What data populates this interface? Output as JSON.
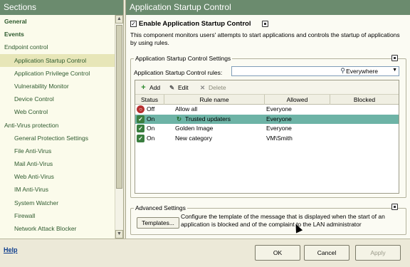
{
  "sidebar": {
    "title": "Sections",
    "items": [
      {
        "label": "General"
      },
      {
        "label": "Events"
      },
      {
        "label": "Endpoint control"
      },
      {
        "label": "Application Startup Control"
      },
      {
        "label": "Application Privilege Control"
      },
      {
        "label": "Vulnerability Monitor"
      },
      {
        "label": "Device Control"
      },
      {
        "label": "Web Control"
      },
      {
        "label": "Anti-Virus protection"
      },
      {
        "label": "General Protection Settings"
      },
      {
        "label": "File Anti-Virus"
      },
      {
        "label": "Mail Anti-Virus"
      },
      {
        "label": "Web Anti-Virus"
      },
      {
        "label": "IM Anti-Virus"
      },
      {
        "label": "System Watcher"
      },
      {
        "label": "Firewall"
      },
      {
        "label": "Network Attack Blocker"
      }
    ]
  },
  "main": {
    "title": "Application Startup Control",
    "enable_checkbox": {
      "label": "Enable Application Startup Control",
      "checked_mark": "✓"
    },
    "description": "This component monitors users' attempts to start applications and controls the startup of applications by using rules.",
    "settings_group": {
      "title": "Application Startup Control Settings",
      "rules_label": "Application Startup Control rules:",
      "filter_value": "Everywhere"
    },
    "toolbar": {
      "add": "Add",
      "edit": "Edit",
      "delete": "Delete"
    },
    "columns": [
      "Status",
      "Rule name",
      "Allowed",
      "Blocked"
    ],
    "rows": [
      {
        "status": "Off",
        "rule": "Allow all",
        "allowed": "Everyone",
        "blocked": ""
      },
      {
        "status": "On",
        "rule": "Trusted updaters",
        "allowed": "Everyone",
        "blocked": ""
      },
      {
        "status": "On",
        "rule": "Golden Image",
        "allowed": "Everyone",
        "blocked": ""
      },
      {
        "status": "On",
        "rule": "New category",
        "allowed": "VM\\Smith",
        "blocked": ""
      }
    ],
    "advanced_group": {
      "title": "Advanced Settings",
      "templates_button": "Templates...",
      "description": "Configure the template of the message that is displayed when the start of an application is blocked and of the complaint to the LAN administrator"
    }
  },
  "footer": {
    "help": "Help",
    "ok": "OK",
    "cancel": "Cancel",
    "apply": "Apply"
  },
  "colors": {
    "header_bg": "#6b8b6e",
    "selected_row": "#6db3a6",
    "nav_text": "#2e5a2e"
  }
}
